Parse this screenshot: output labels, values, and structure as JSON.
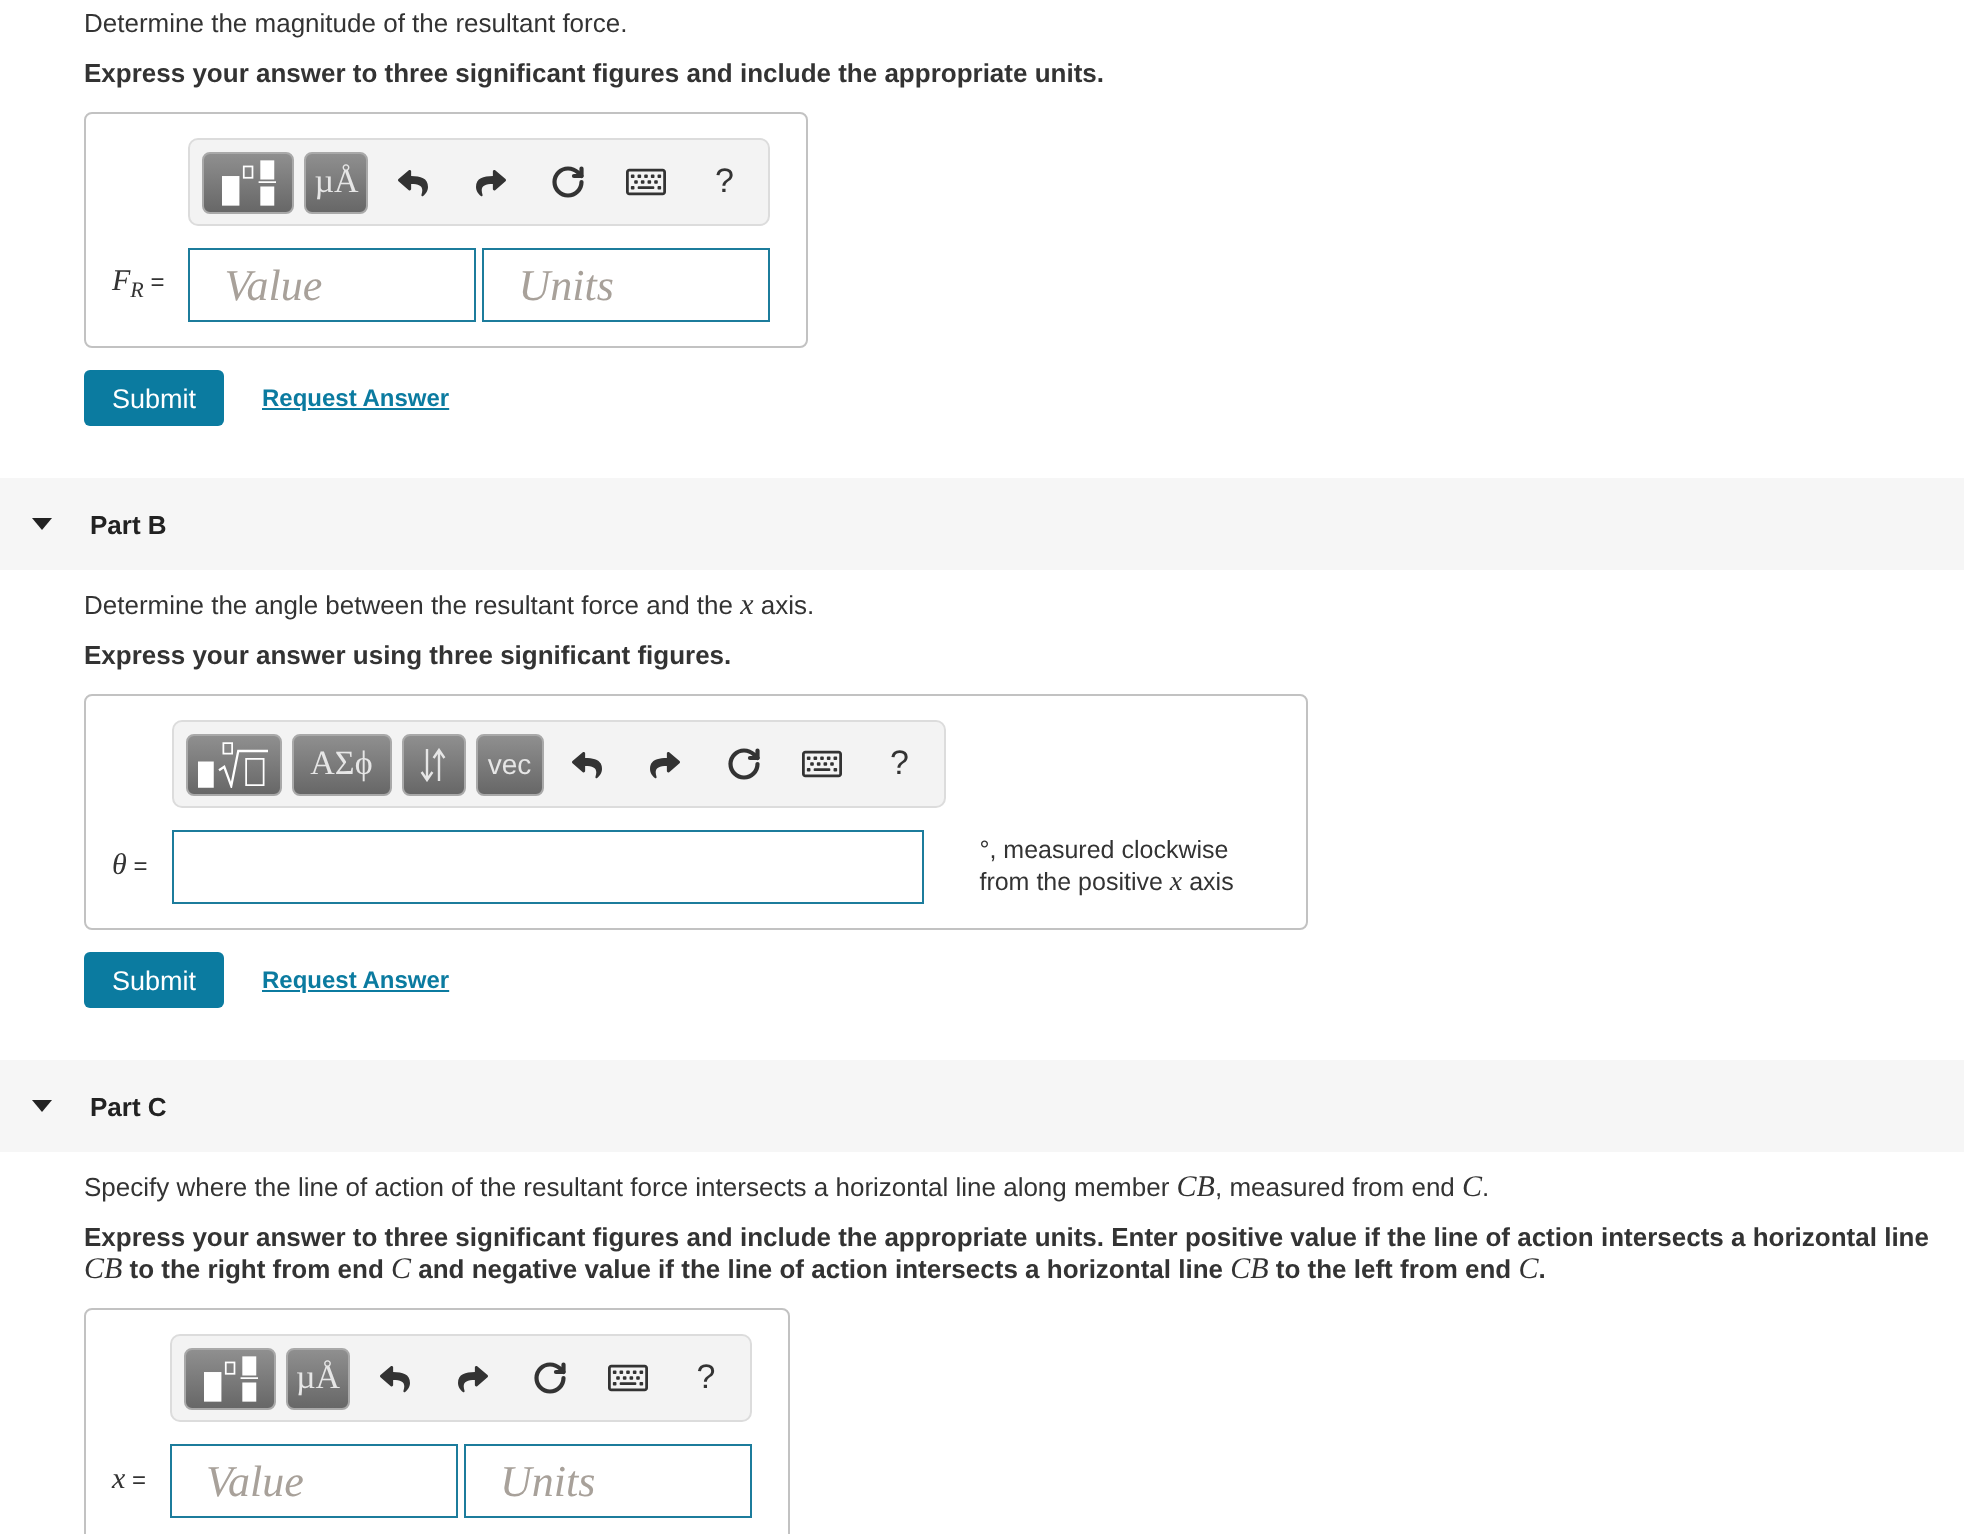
{
  "parts": [
    {
      "prompt": "Determine the magnitude of the resultant force.",
      "instruction": "Express your answer to three significant figures and include the appropriate units.",
      "answer": {
        "toolbar": [
          {
            "kind": "templates"
          },
          {
            "kind": "units",
            "label": "µÅ"
          },
          {
            "kind": "undo"
          },
          {
            "kind": "redo"
          },
          {
            "kind": "reset"
          },
          {
            "kind": "keyboard"
          },
          {
            "kind": "help",
            "label": "?"
          }
        ],
        "label": "*F*$_{R}$ =",
        "fields": [
          {
            "kind": "value",
            "placeholder": "Value"
          },
          {
            "kind": "units",
            "placeholder": "Units"
          }
        ]
      },
      "actions": {
        "submit": "Submit",
        "request": "Request Answer"
      }
    },
    {
      "title": "Part B",
      "expanded": true,
      "prompt": "Determine the angle between the resultant force and the *x* axis.",
      "instruction": "Express your answer using three significant figures.",
      "answer": {
        "toolbar": [
          {
            "kind": "radical"
          },
          {
            "kind": "symbols",
            "label": "ΑΣϕ"
          },
          {
            "kind": "arrows"
          },
          {
            "kind": "vector",
            "label": "vec"
          },
          {
            "kind": "undo"
          },
          {
            "kind": "redo"
          },
          {
            "kind": "reset"
          },
          {
            "kind": "keyboard"
          },
          {
            "kind": "help",
            "label": "?"
          }
        ],
        "label": "*θ* =",
        "fields": [
          {
            "kind": "wide"
          }
        ],
        "suffix": "°, measured clockwise from the positive *x* axis"
      },
      "actions": {
        "submit": "Submit",
        "request": "Request Answer"
      }
    },
    {
      "title": "Part C",
      "expanded": true,
      "prompt": "Specify where the line of action of the resultant force intersects a horizontal line along member *CB*, measured from end *C*.",
      "instruction": "Express your answer to three significant figures and include the appropriate units. Enter positive value if the line of action intersects a horizontal line *CB* to the right from end *C* and negative value if the line of action intersects a horizontal line *CB* to the left from end *C*.",
      "answer": {
        "toolbar": [
          {
            "kind": "templates"
          },
          {
            "kind": "units",
            "label": "µÅ"
          },
          {
            "kind": "undo"
          },
          {
            "kind": "redo"
          },
          {
            "kind": "reset"
          },
          {
            "kind": "keyboard"
          },
          {
            "kind": "help",
            "label": "?"
          }
        ],
        "label": "*x* =",
        "fields": [
          {
            "kind": "value",
            "placeholder": "Value"
          },
          {
            "kind": "units",
            "placeholder": "Units"
          }
        ]
      }
    }
  ]
}
